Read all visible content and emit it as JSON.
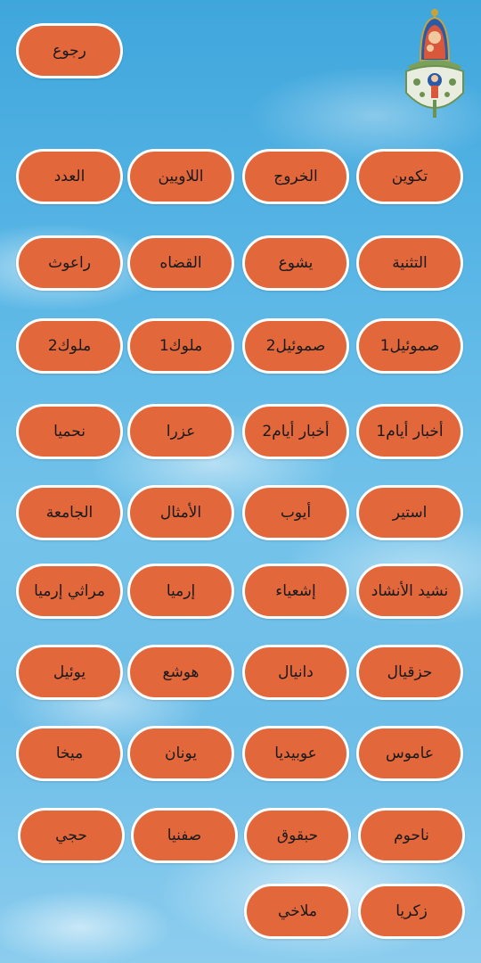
{
  "header": {
    "back_label": "رجوع"
  },
  "books": [
    "تكوين",
    "الخروج",
    "اللاويين",
    "العدد",
    "التثنية",
    "يشوع",
    "القضاه",
    "راعوث",
    "صموئيل1",
    "صموئيل2",
    "ملوك1",
    "ملوك2",
    "أخبار أيام1",
    "أخبار أيام2",
    "عزرا",
    "نحميا",
    "استير",
    "أيوب",
    "الأمثال",
    "الجامعة",
    "نشيد الأنشاد",
    "إشعياء",
    "إرميا",
    "مراثي إرميا",
    "حزقيال",
    "دانيال",
    "هوشع",
    "يوئيل",
    "عاموس",
    "عوبيديا",
    "يونان",
    "ميخا",
    "ناحوم",
    "حبقوق",
    "صفنيا",
    "حجي",
    "زكريا",
    "ملاخي"
  ],
  "colors": {
    "button_fill": "#e2673b",
    "button_border": "#ffffff",
    "sky": "#5bb7e6"
  },
  "icons": {
    "logo": "church-icon"
  }
}
